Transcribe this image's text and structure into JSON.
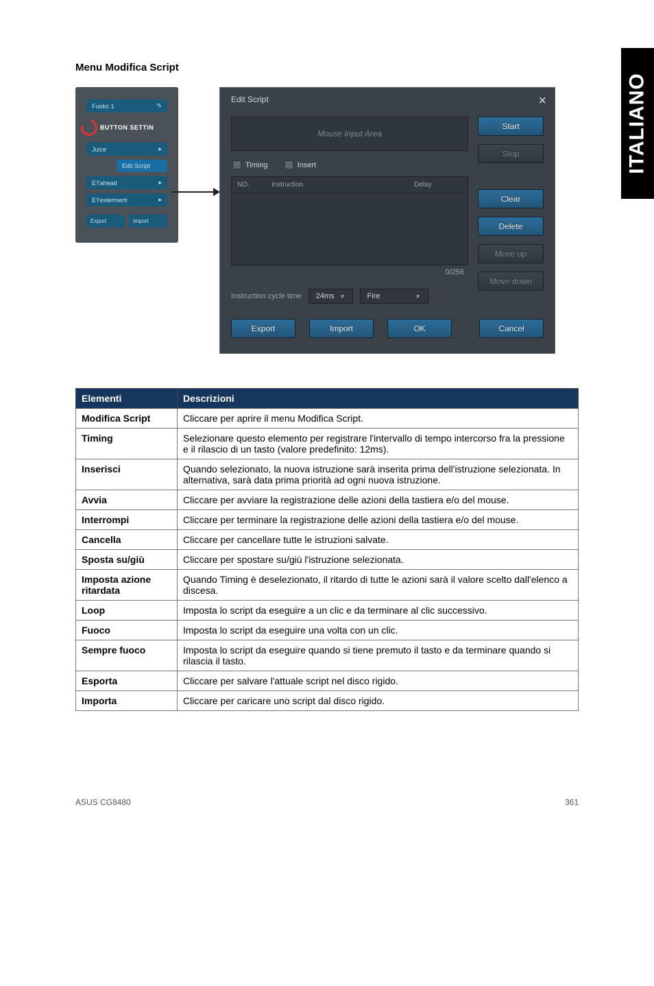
{
  "sideTab": "ITALIANO",
  "sectionTitle": "Menu Modifica Script",
  "leftPanel": {
    "topChip": "Fuoko 1",
    "logoText": "BUTTON SETTIN",
    "items": [
      "Juice",
      "Edit Script",
      "E'l'ahead",
      "E'l'esterment"
    ],
    "exportBtn": "Export",
    "importBtn": "Import"
  },
  "dialog": {
    "title": "Edit Script",
    "inputArea": "Mouse Input Area",
    "timing": "Timing",
    "insert": "Insert",
    "cols": {
      "no": "NO.",
      "instruction": "Instruction",
      "delay": "Delay"
    },
    "counter": "0/256",
    "cycleLabel": "Instruction cycle time",
    "cycleValue": "24ms",
    "fireLabel": "Fire",
    "btns": {
      "start": "Start",
      "stop": "Stop",
      "clear": "Clear",
      "delete": "Delete",
      "moveup": "Move up",
      "movedown": "Move down",
      "export": "Export",
      "import": "Import",
      "ok": "OK",
      "cancel": "Cancel"
    }
  },
  "table": {
    "h1": "Elementi",
    "h2": "Descrizioni",
    "rows": [
      {
        "k": "Modifica Script",
        "v": "Cliccare per aprire il menu Modifica Script."
      },
      {
        "k": "Timing",
        "v": "Selezionare questo elemento per registrare l'intervallo di tempo intercorso fra la pressione e il rilascio di un tasto (valore predefinito: 12ms)."
      },
      {
        "k": "Inserisci",
        "v": "Quando selezionato, la nuova istruzione sarà inserita prima dell'istruzione selezionata. In alternativa, sarà data prima priorità ad ogni nuova istruzione."
      },
      {
        "k": "Avvia",
        "v": "Cliccare per avviare la registrazione delle azioni della tastiera e/o del mouse."
      },
      {
        "k": "Interrompi",
        "v": "Cliccare per terminare la registrazione delle azioni della tastiera e/o del mouse."
      },
      {
        "k": "Cancella",
        "v": "Cliccare per cancellare tutte le istruzioni salvate."
      },
      {
        "k": "Sposta su/giù",
        "v": "Cliccare per spostare su/giù l'istruzione selezionata."
      },
      {
        "k": "Imposta azione ritardata",
        "v": "Quando Timing è deselezionato, il ritardo di tutte le azioni sarà il valore scelto dall'elenco a discesa."
      },
      {
        "k": "Loop",
        "v": "Imposta lo script da eseguire a un clic e da terminare al clic successivo."
      },
      {
        "k": "Fuoco",
        "v": "Imposta  lo script da eseguire una volta con un clic."
      },
      {
        "k": "Sempre fuoco",
        "v": "Imposta lo script da eseguire quando si tiene premuto il tasto e da terminare quando si rilascia il tasto."
      },
      {
        "k": "Esporta",
        "v": "Cliccare per salvare l'attuale script nel disco rigido."
      },
      {
        "k": "Importa",
        "v": "Cliccare per caricare uno script dal disco rigido."
      }
    ]
  },
  "footer": {
    "left": "ASUS CG8480",
    "right": "361"
  }
}
